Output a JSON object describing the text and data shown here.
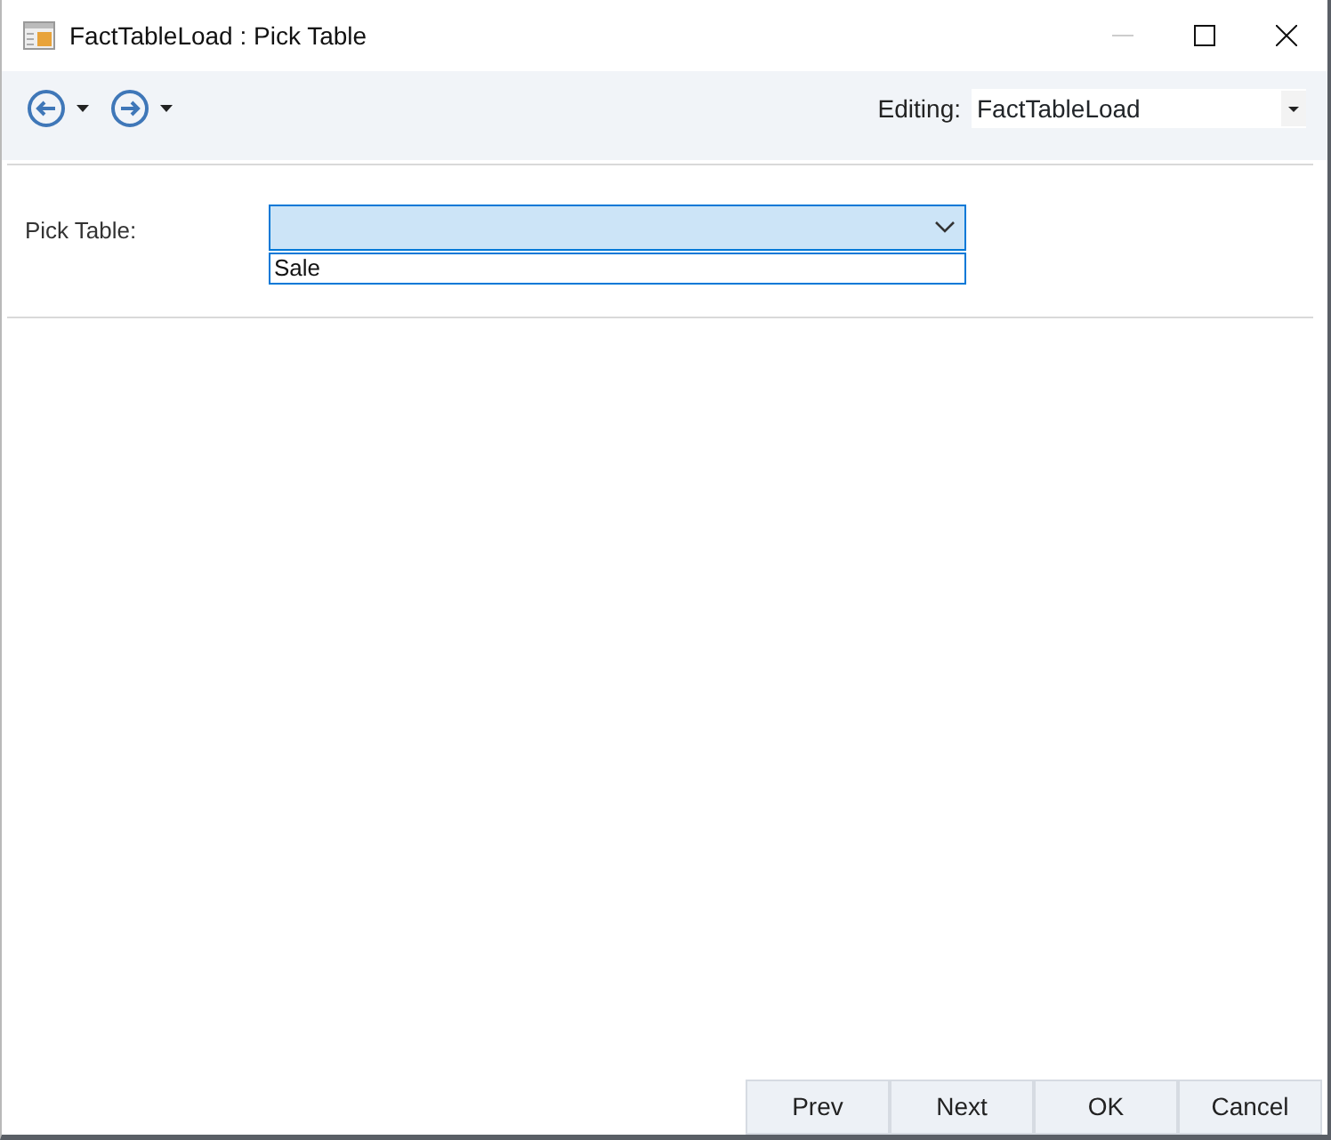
{
  "window": {
    "title": "FactTableLoad : Pick Table"
  },
  "toolbar": {
    "editing_label": "Editing:",
    "editing_value": "FactTableLoad"
  },
  "form": {
    "label": "Pick Table:",
    "dropdown": {
      "expanded": true,
      "options": [
        {
          "label": "Sale",
          "selected": false
        }
      ]
    }
  },
  "buttons": [
    "Prev",
    "Next",
    "OK",
    "Cancel"
  ]
}
